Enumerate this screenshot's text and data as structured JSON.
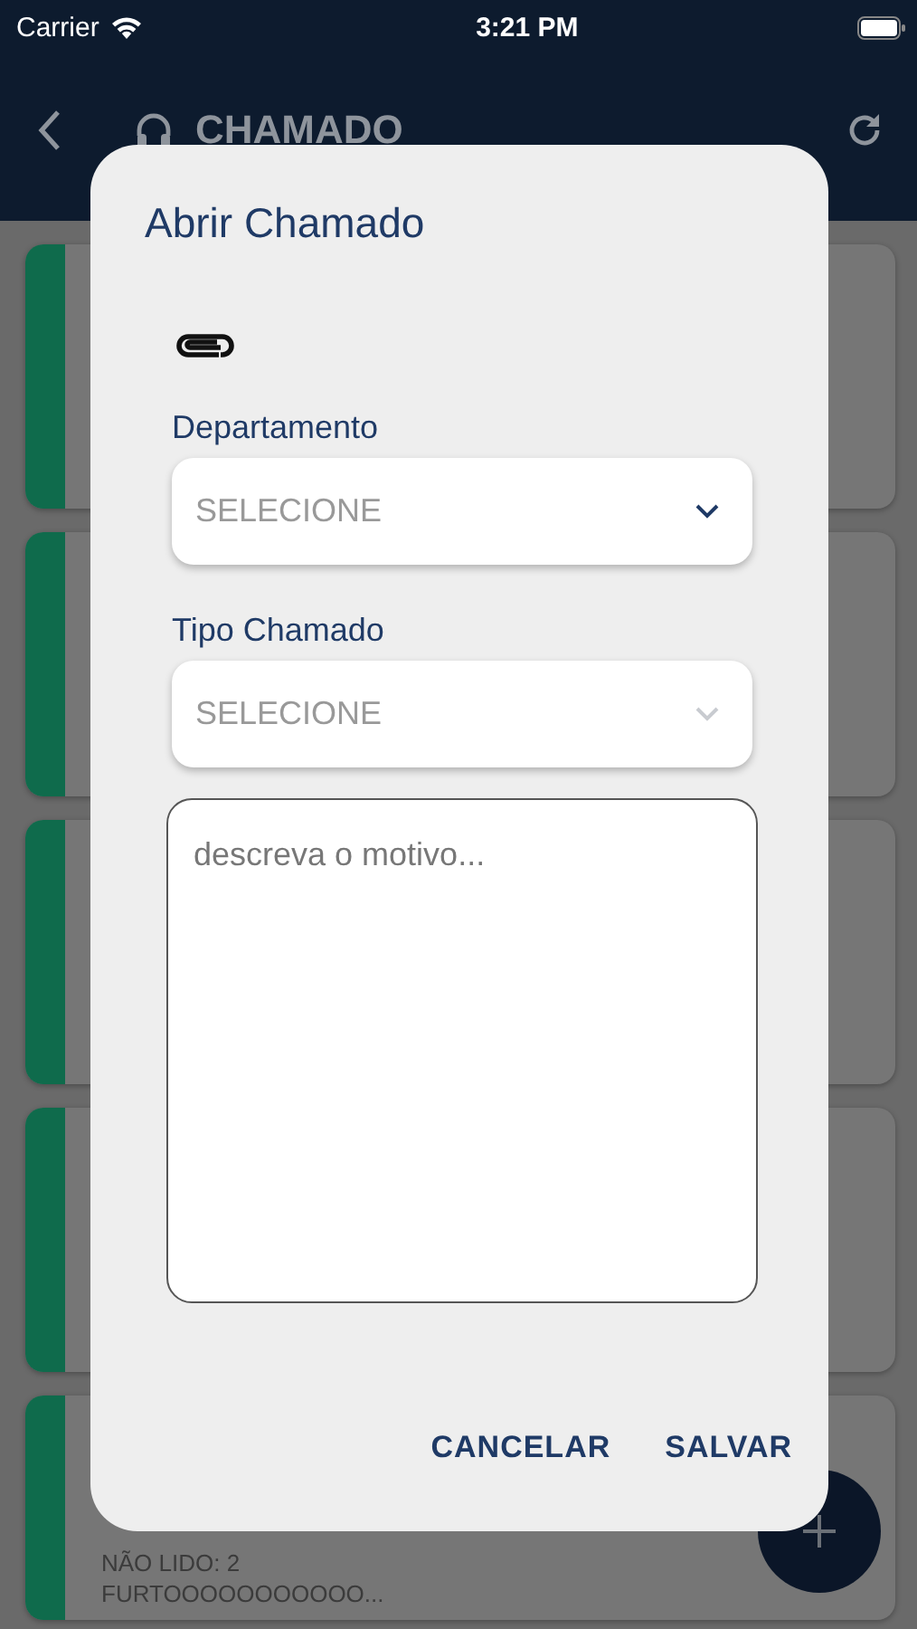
{
  "status_bar": {
    "carrier": "Carrier",
    "time": "3:21 PM"
  },
  "header": {
    "title": "CHAMADO"
  },
  "cards": [
    {
      "kind": "covered"
    },
    {
      "kind": "covered"
    },
    {
      "kind": "covered"
    },
    {
      "kind": "covered"
    },
    {
      "kind": "ticket",
      "lines": [
        "NÃO LIDO: 2",
        "FURTOOOOOOOOOOO..."
      ]
    }
  ],
  "dialog": {
    "title": "Abrir Chamado",
    "fields": [
      {
        "label": "Departamento",
        "placeholder": "SELECIONE",
        "disabled": false
      },
      {
        "label": "Tipo Chamado",
        "placeholder": "SELECIONE",
        "disabled": true
      }
    ],
    "description": {
      "placeholder": "descreva o motivo..."
    },
    "buttons": [
      "CANCELAR",
      "SALVAR"
    ]
  }
}
